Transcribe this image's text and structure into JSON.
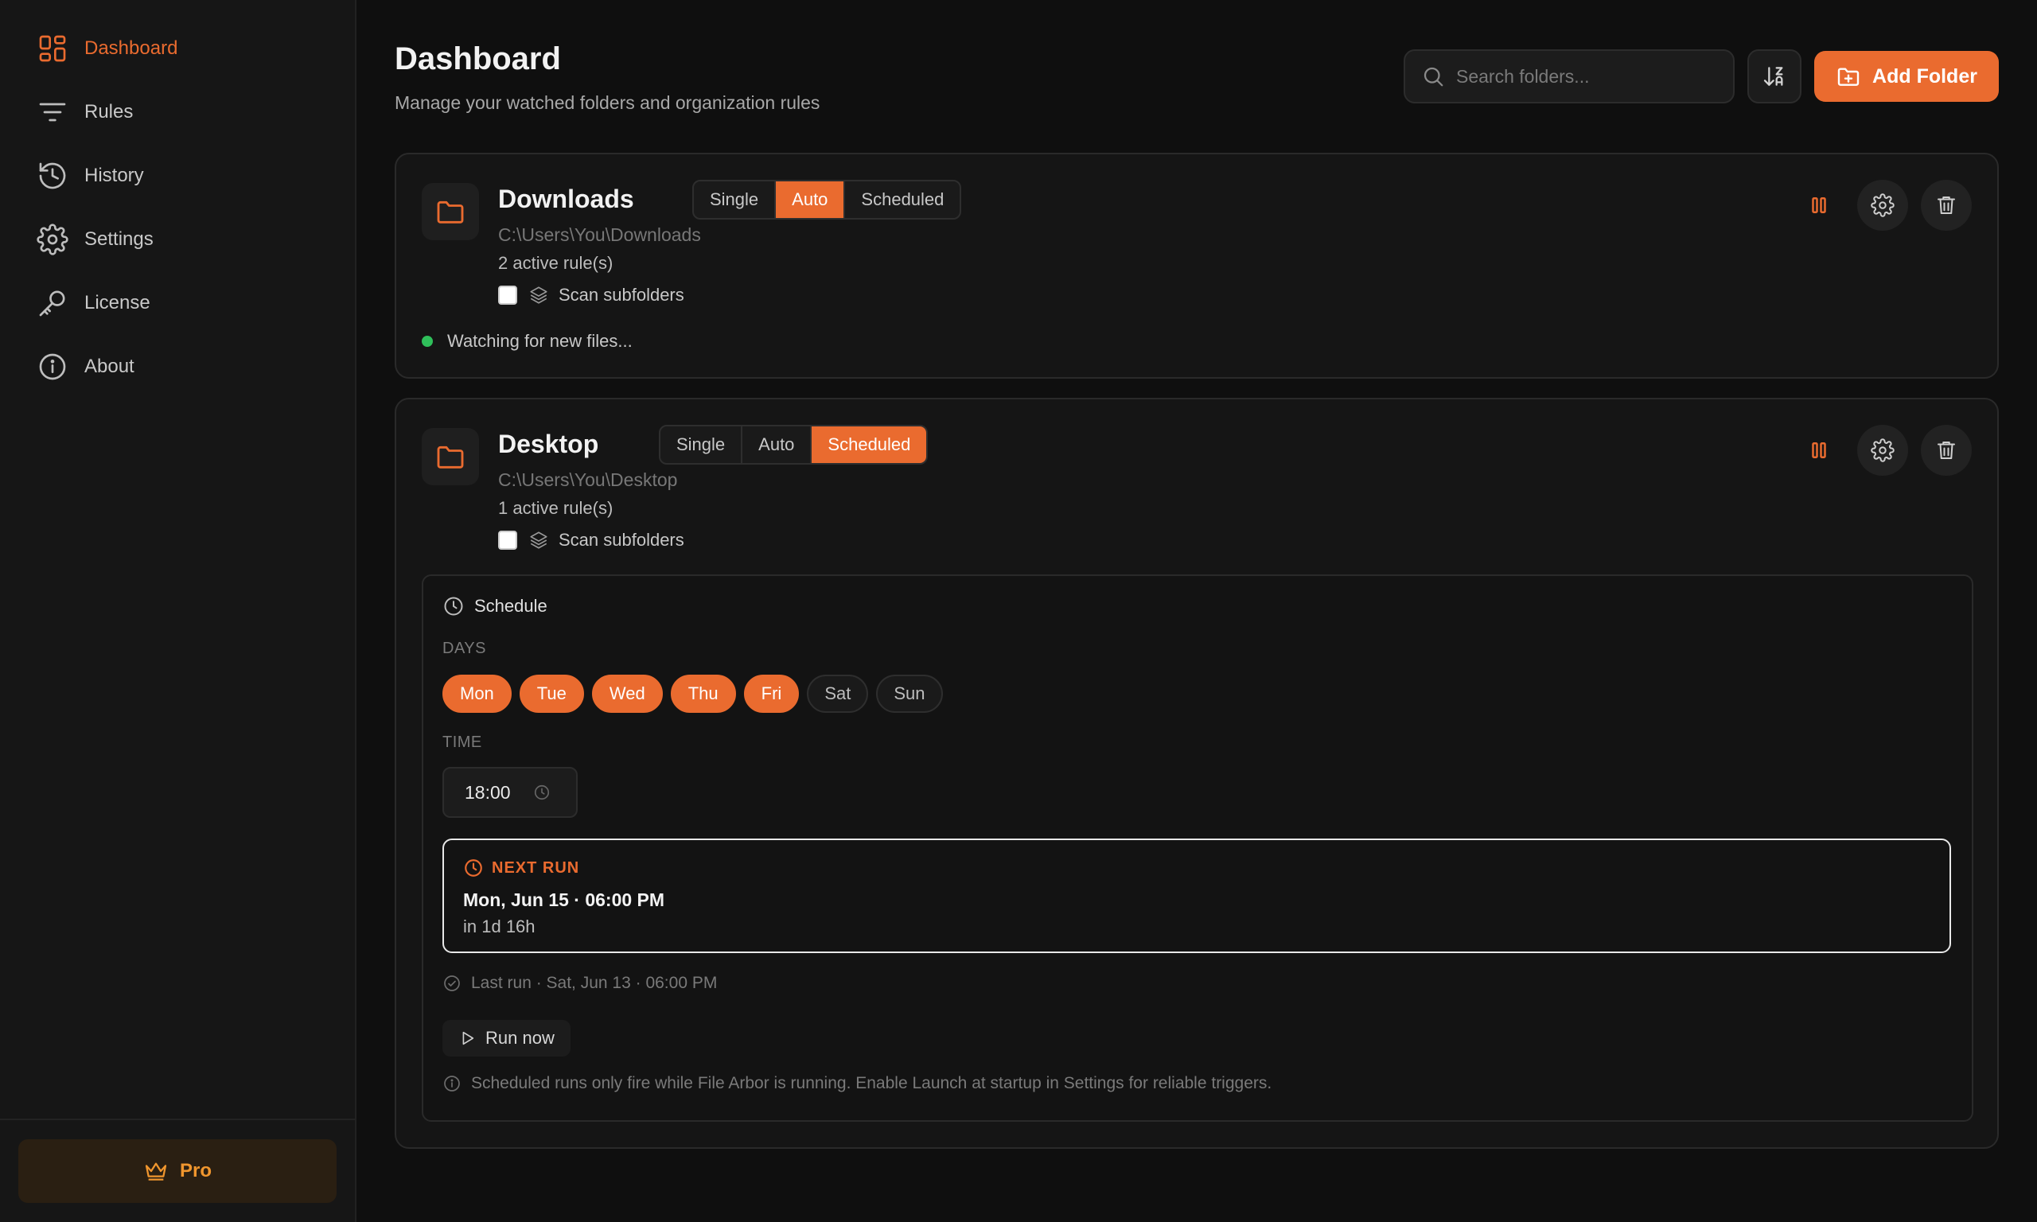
{
  "sidebar": {
    "items": [
      {
        "label": "Dashboard",
        "icon": "grid-icon",
        "active": true
      },
      {
        "label": "Rules",
        "icon": "filter-icon",
        "active": false
      },
      {
        "label": "History",
        "icon": "history-icon",
        "active": false
      },
      {
        "label": "Settings",
        "icon": "gear-icon",
        "active": false
      },
      {
        "label": "License",
        "icon": "key-icon",
        "active": false
      },
      {
        "label": "About",
        "icon": "info-icon",
        "active": false
      }
    ],
    "pro_label": "Pro"
  },
  "header": {
    "title": "Dashboard",
    "subtitle": "Manage your watched folders and organization rules",
    "search_placeholder": "Search folders...",
    "add_folder_label": "Add Folder"
  },
  "modes": [
    "Single",
    "Auto",
    "Scheduled"
  ],
  "folders": [
    {
      "name": "Downloads",
      "path": "C:\\Users\\You\\Downloads",
      "rules": "2 active rule(s)",
      "scan_label": "Scan subfolders",
      "scan_checked": false,
      "mode": "Auto",
      "status": "Watching for new files..."
    },
    {
      "name": "Desktop",
      "path": "C:\\Users\\You\\Desktop",
      "rules": "1 active rule(s)",
      "scan_label": "Scan subfolders",
      "scan_checked": false,
      "mode": "Scheduled",
      "schedule": {
        "title": "Schedule",
        "days_label": "DAYS",
        "days": [
          {
            "label": "Mon",
            "on": true
          },
          {
            "label": "Tue",
            "on": true
          },
          {
            "label": "Wed",
            "on": true
          },
          {
            "label": "Thu",
            "on": true
          },
          {
            "label": "Fri",
            "on": true
          },
          {
            "label": "Sat",
            "on": false
          },
          {
            "label": "Sun",
            "on": false
          }
        ],
        "time_label": "TIME",
        "time": "18:00",
        "next_run_label": "NEXT RUN",
        "next_run_date": "Mon, Jun 15 · 06:00 PM",
        "next_run_relative": "in 1d 16h",
        "last_run": "Last run · Sat, Jun 13 · 06:00 PM",
        "run_now_label": "Run now",
        "note": "Scheduled runs only fire while File Arbor is running. Enable Launch at startup in Settings for reliable triggers."
      }
    }
  ],
  "colors": {
    "accent": "#ea6b2f",
    "background": "#0f0f0f",
    "sidebar": "#161616",
    "card": "#151515",
    "status_green": "#2fbf5a",
    "pro_text": "#f0962e"
  }
}
